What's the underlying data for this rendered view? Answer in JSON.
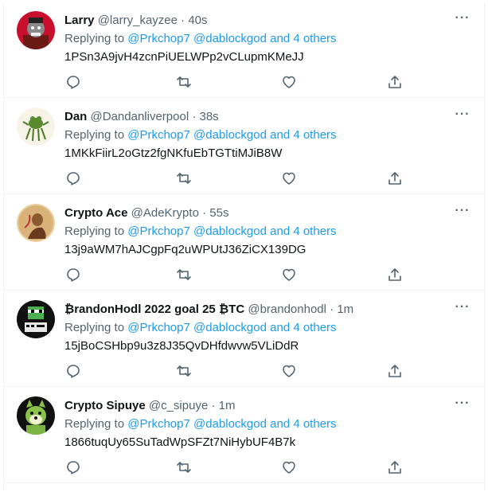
{
  "colors": {
    "text": "#0f1419",
    "secondary": "#536471",
    "link": "#1d9bf0",
    "divider": "#eff3f4"
  },
  "more_label": "···",
  "tweets": [
    {
      "name": "Larry",
      "handle": "@larry_kayzee",
      "dot": "·",
      "time": "40s",
      "replying_prefix": "Replying to ",
      "mention1": "@Prkchop7",
      "mention2": "@dablockgod",
      "others": "and 4 others",
      "text": "1PSn3A9jvH4zcnPiUELWPp2vCLupmKMeJJ",
      "avatar_icon": "ape-avatar-icon"
    },
    {
      "name": "Dan",
      "handle": "@Dandanliverpool",
      "dot": "·",
      "time": "38s",
      "replying_prefix": "Replying to ",
      "mention1": "@Prkchop7",
      "mention2": "@dablockgod",
      "others": "and 4 others",
      "text": "1MKkFiirL2oGtz2fgNKfuEbTGTtiMJiB8W",
      "avatar_icon": "frog-avatar-icon"
    },
    {
      "name": "Crypto Ace",
      "handle": "@AdeKrypto",
      "dot": "·",
      "time": "55s",
      "replying_prefix": "Replying to ",
      "mention1": "@Prkchop7",
      "mention2": "@dablockgod",
      "others": "and 4 others",
      "text": "13j9aWM7hAJCgpFq2uWPUtJ36ZiCX139DG",
      "avatar_icon": "painting-avatar-icon"
    },
    {
      "name": "₿randonHodl 2022 goal 25 ₿TC",
      "handle": "@brandonhodl",
      "dot": "·",
      "time": "1m",
      "replying_prefix": "Replying to ",
      "mention1": "@Prkchop7",
      "mention2": "@dablockgod",
      "others": "and 4 others",
      "text": "15jBoCSHbp9u3z8J35QvDHfdwvw5VLiDdR",
      "avatar_icon": "pixel-pepe-avatar-icon"
    },
    {
      "name": "Crypto Sipuye",
      "handle": "@c_sipuye",
      "dot": "·",
      "time": "1m",
      "replying_prefix": "Replying to ",
      "mention1": "@Prkchop7",
      "mention2": "@dablockgod",
      "others": "and 4 others",
      "text": "1866tuqUy65SuTadWpSFZt7NiHybUF4B7k",
      "avatar_icon": "shiba-avatar-icon"
    }
  ]
}
